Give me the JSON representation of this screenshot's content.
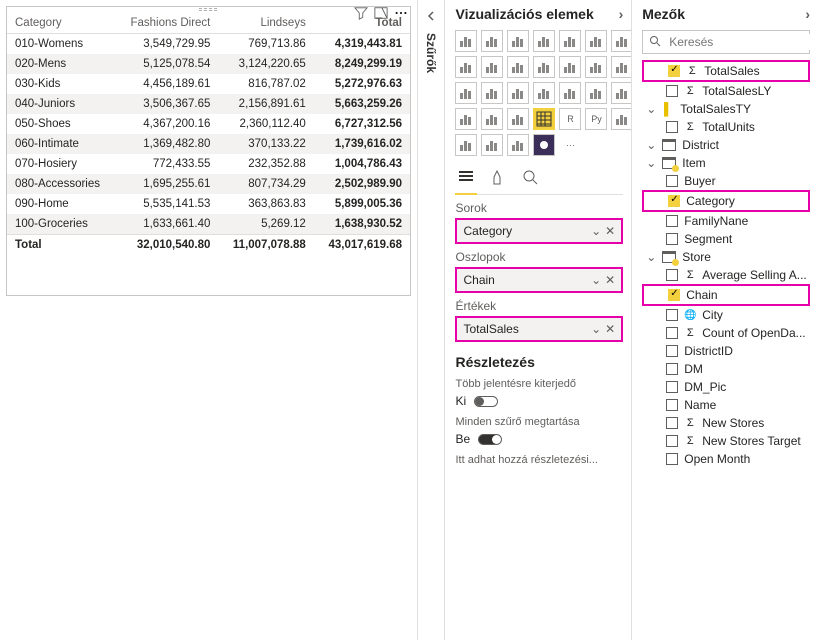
{
  "panes": {
    "filters_label": "Szűrők",
    "visualizations_label": "Vizualizációs elemek",
    "fields_label": "Mezők"
  },
  "matrix": {
    "headers": [
      "Category",
      "Fashions Direct",
      "Lindseys",
      "Total"
    ],
    "rows": [
      {
        "c": "010-Womens",
        "a": "3,549,729.95",
        "b": "769,713.86",
        "t": "4,319,443.81"
      },
      {
        "c": "020-Mens",
        "a": "5,125,078.54",
        "b": "3,124,220.65",
        "t": "8,249,299.19"
      },
      {
        "c": "030-Kids",
        "a": "4,456,189.61",
        "b": "816,787.02",
        "t": "5,272,976.63"
      },
      {
        "c": "040-Juniors",
        "a": "3,506,367.65",
        "b": "2,156,891.61",
        "t": "5,663,259.26"
      },
      {
        "c": "050-Shoes",
        "a": "4,367,200.16",
        "b": "2,360,112.40",
        "t": "6,727,312.56"
      },
      {
        "c": "060-Intimate",
        "a": "1,369,482.80",
        "b": "370,133.22",
        "t": "1,739,616.02"
      },
      {
        "c": "070-Hosiery",
        "a": "772,433.55",
        "b": "232,352.88",
        "t": "1,004,786.43"
      },
      {
        "c": "080-Accessories",
        "a": "1,695,255.61",
        "b": "807,734.29",
        "t": "2,502,989.90"
      },
      {
        "c": "090-Home",
        "a": "5,535,141.53",
        "b": "363,863.83",
        "t": "5,899,005.36"
      },
      {
        "c": "100-Groceries",
        "a": "1,633,661.40",
        "b": "5,269.12",
        "t": "1,638,930.52"
      }
    ],
    "totals": {
      "c": "Total",
      "a": "32,010,540.80",
      "b": "11,007,078.88",
      "t": "43,017,619.68"
    }
  },
  "visPane": {
    "sections": {
      "rows": "Sorok",
      "cols": "Oszlopok",
      "values": "Értékek"
    },
    "wells": {
      "rows": "Category",
      "cols": "Chain",
      "values": "TotalSales"
    },
    "drill": {
      "title": "Részletezés",
      "cross_label": "Több jelentésre kiterjedő",
      "cross_state": "Ki",
      "keep_label": "Minden szűrő megtartása",
      "keep_state": "Be",
      "hint": "Itt adhat hozzá részletezési..."
    }
  },
  "fieldsPane": {
    "search_placeholder": "Keresés",
    "top_fields": [
      {
        "label": "TotalSales",
        "checked": true,
        "hl": true,
        "icon": "sigma"
      },
      {
        "label": "TotalSalesLY",
        "checked": false,
        "icon": "sigma"
      }
    ],
    "tables": [
      {
        "name": "TotalSalesTY",
        "kind": "field",
        "children": [
          {
            "label": "TotalUnits",
            "icon": "sigma"
          }
        ]
      },
      {
        "name": "District",
        "kind": "table"
      },
      {
        "name": "Item",
        "kind": "table",
        "children": [
          {
            "label": "Buyer"
          },
          {
            "label": "Category",
            "checked": true,
            "hl": true
          },
          {
            "label": "FamilyNane"
          },
          {
            "label": "Segment"
          }
        ]
      },
      {
        "name": "Store",
        "kind": "table",
        "children": [
          {
            "label": "Average Selling A...",
            "icon": "sigma"
          },
          {
            "label": "Chain",
            "checked": true,
            "hl": true
          },
          {
            "label": "City",
            "icon": "globe"
          },
          {
            "label": "Count of OpenDa...",
            "icon": "sigma"
          },
          {
            "label": "DistrictID"
          },
          {
            "label": "DM"
          },
          {
            "label": "DM_Pic"
          },
          {
            "label": "Name"
          },
          {
            "label": "New Stores",
            "icon": "sigma"
          },
          {
            "label": "New Stores Target",
            "icon": "sigma"
          },
          {
            "label": "Open Month"
          }
        ]
      }
    ]
  },
  "chart_data": {
    "type": "table",
    "title": "TotalSales by Category and Chain",
    "row_field": "Category",
    "column_field": "Chain",
    "value_field": "TotalSales",
    "columns": [
      "Fashions Direct",
      "Lindseys"
    ],
    "rows": [
      {
        "Category": "010-Womens",
        "Fashions Direct": 3549729.95,
        "Lindseys": 769713.86,
        "Total": 4319443.81
      },
      {
        "Category": "020-Mens",
        "Fashions Direct": 5125078.54,
        "Lindseys": 3124220.65,
        "Total": 8249299.19
      },
      {
        "Category": "030-Kids",
        "Fashions Direct": 4456189.61,
        "Lindseys": 816787.02,
        "Total": 5272976.63
      },
      {
        "Category": "040-Juniors",
        "Fashions Direct": 3506367.65,
        "Lindseys": 2156891.61,
        "Total": 5663259.26
      },
      {
        "Category": "050-Shoes",
        "Fashions Direct": 4367200.16,
        "Lindseys": 2360112.4,
        "Total": 6727312.56
      },
      {
        "Category": "060-Intimate",
        "Fashions Direct": 1369482.8,
        "Lindseys": 370133.22,
        "Total": 1739616.02
      },
      {
        "Category": "070-Hosiery",
        "Fashions Direct": 772433.55,
        "Lindseys": 232352.88,
        "Total": 1004786.43
      },
      {
        "Category": "080-Accessories",
        "Fashions Direct": 1695255.61,
        "Lindseys": 807734.29,
        "Total": 2502989.9
      },
      {
        "Category": "090-Home",
        "Fashions Direct": 5535141.53,
        "Lindseys": 363863.83,
        "Total": 5899005.36
      },
      {
        "Category": "100-Groceries",
        "Fashions Direct": 1633661.4,
        "Lindseys": 5269.12,
        "Total": 1638930.52
      }
    ],
    "grand_total": {
      "Fashions Direct": 32010540.8,
      "Lindseys": 11007078.88,
      "Total": 43017619.68
    }
  }
}
